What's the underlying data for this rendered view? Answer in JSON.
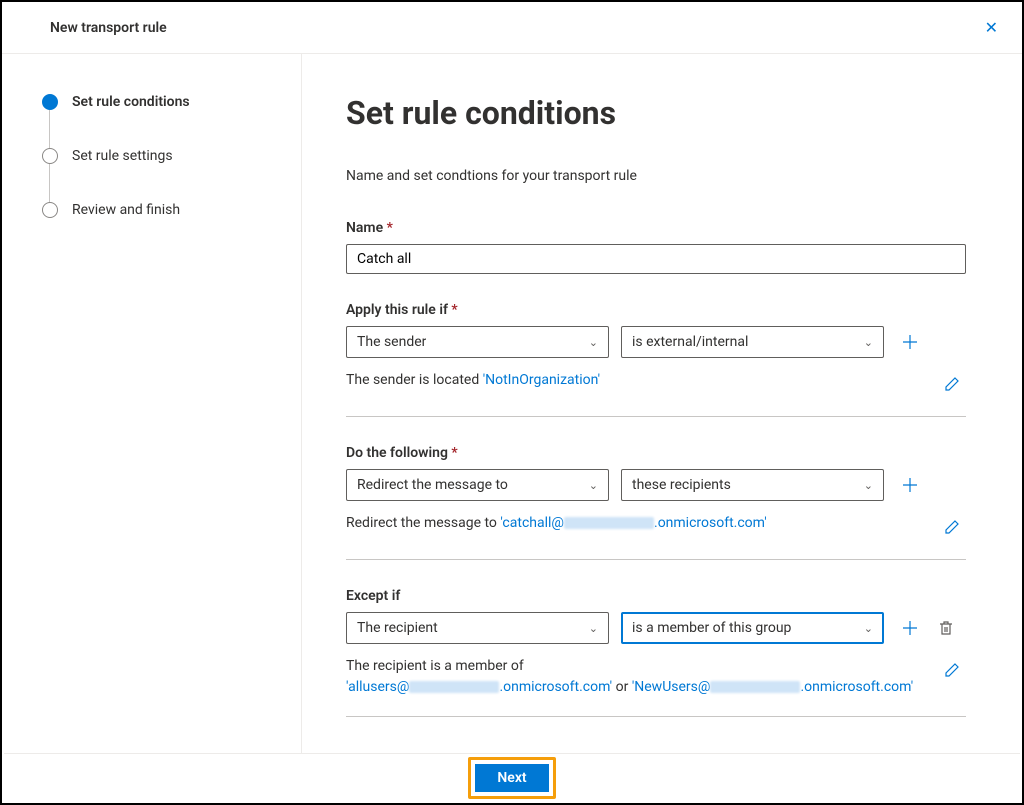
{
  "header": {
    "title": "New transport rule"
  },
  "sidebar": {
    "steps": [
      {
        "label": "Set rule conditions",
        "active": true
      },
      {
        "label": "Set rule settings",
        "active": false
      },
      {
        "label": "Review and finish",
        "active": false
      }
    ]
  },
  "main": {
    "title": "Set rule conditions",
    "subtitle": "Name and set condtions for your transport rule",
    "name_label": "Name",
    "name_value": "Catch all",
    "apply_label": "Apply this rule if",
    "apply_select1": "The sender",
    "apply_select2": "is external/internal",
    "apply_summary_prefix": "The sender is located ",
    "apply_summary_value": "'NotInOrganization'",
    "do_label": "Do the following",
    "do_select1": "Redirect the message to",
    "do_select2": "these recipients",
    "do_summary_prefix": "Redirect the message to ",
    "do_summary_value1": "'catchall@",
    "do_summary_value2": ".onmicrosoft.com'",
    "except_label": "Except if",
    "except_select1": "The recipient",
    "except_select2": "is a member of this group",
    "except_summary_line1": "The recipient is a member of",
    "except_summary_a1": "'allusers@",
    "except_summary_a2": ".onmicrosoft.com'",
    "except_summary_or": " or ",
    "except_summary_b1": "'NewUsers@",
    "except_summary_b2": ".onmicrosoft.com'"
  },
  "footer": {
    "next": "Next"
  }
}
